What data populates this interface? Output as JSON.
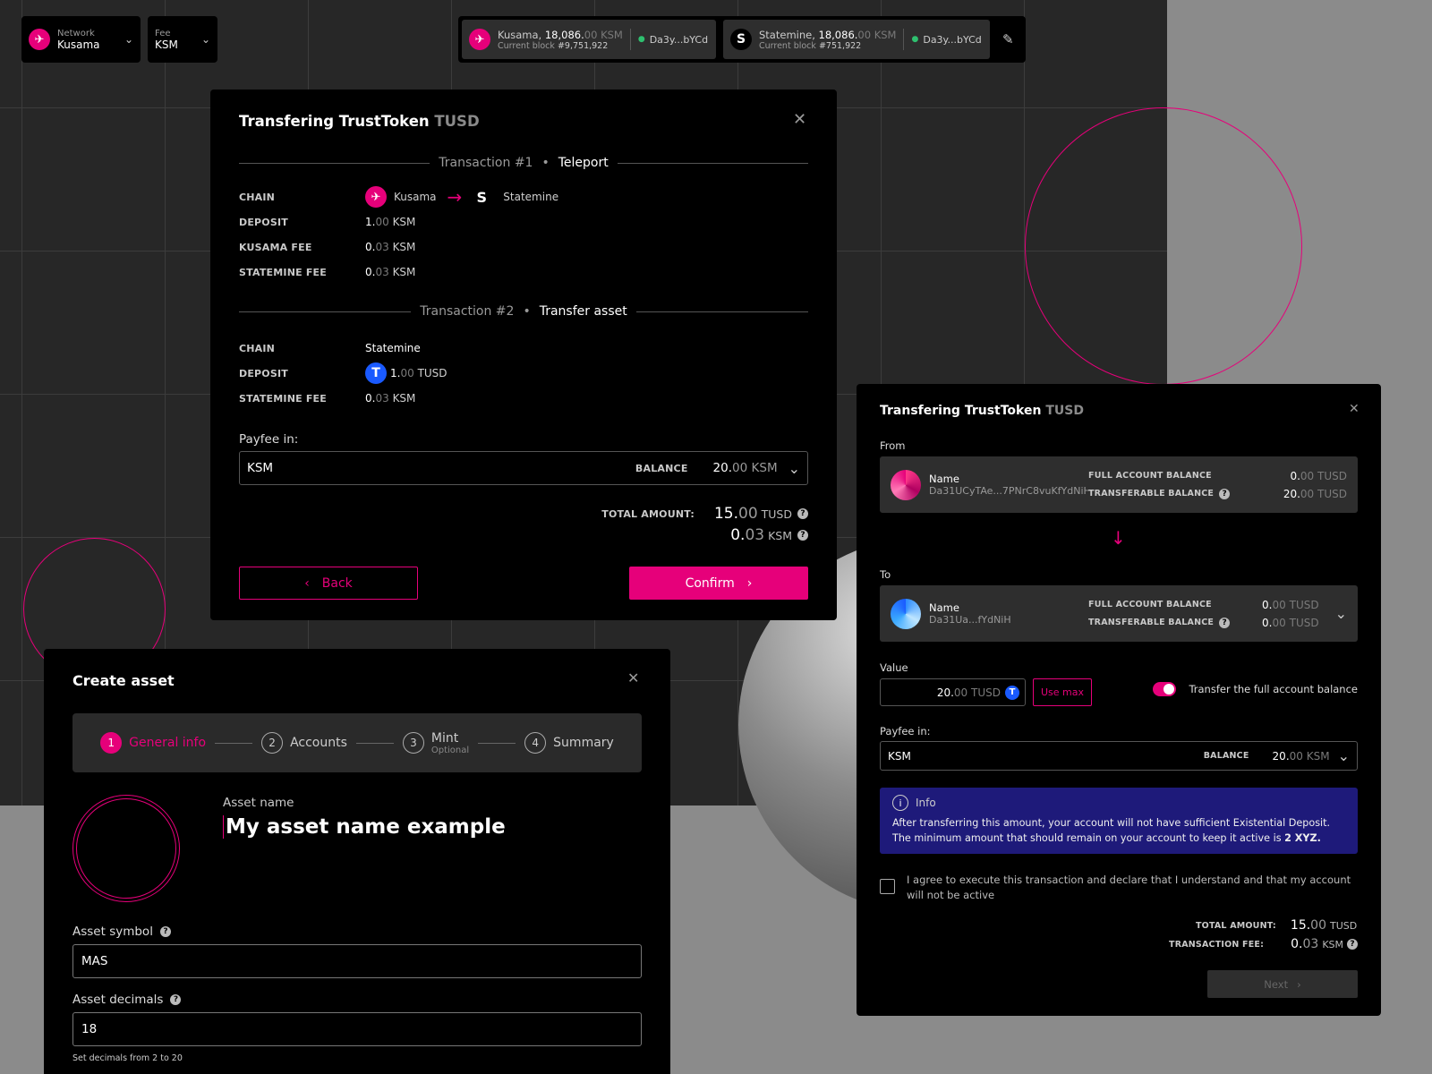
{
  "topbar": {
    "network_label": "Network",
    "network_value": "Kusama",
    "fee_label": "Fee",
    "fee_value": "KSM",
    "conn1": {
      "name": "Kusama,",
      "amount_int": "18,086.",
      "amount_dec": "00",
      "unit": "KSM",
      "block_label": "Current block",
      "block": "#9,751,922",
      "address": "Da3y...bYCd"
    },
    "conn2": {
      "name": "Statemine,",
      "amount_int": "18,086.",
      "amount_dec": "00",
      "unit": "KSM",
      "block_label": "Current block",
      "block": "#751,922",
      "address": "Da3y...bYCd"
    }
  },
  "teleport": {
    "title": "Transfering TrustToken",
    "title_symbol": "TUSD",
    "tx1_label": "Transaction #1",
    "tx1_type": "Teleport",
    "tx1": {
      "chain_label": "CHAIN",
      "from": "Kusama",
      "to": "Statemine",
      "deposit_label": "DEPOSIT",
      "deposit_int": "1.",
      "deposit_dec": "00",
      "deposit_unit": "KSM",
      "kfee_label": "KUSAMA FEE",
      "kfee_int": "0.",
      "kfee_dec": "03",
      "kfee_unit": "KSM",
      "sfee_label": "STATEMINE FEE",
      "sfee_int": "0.",
      "sfee_dec": "03",
      "sfee_unit": "KSM"
    },
    "tx2_label": "Transaction #2",
    "tx2_type": "Transfer asset",
    "tx2": {
      "chain_label": "CHAIN",
      "chain": "Statemine",
      "deposit_label": "DEPOSIT",
      "deposit_int": "1.",
      "deposit_dec": "00",
      "deposit_unit": "TUSD",
      "sfee_label": "STATEMINE FEE",
      "sfee_int": "0.",
      "sfee_dec": "03",
      "sfee_unit": "KSM"
    },
    "payfee_label": "Payfee in:",
    "payfee_value": "KSM",
    "balance_label": "BALANCE",
    "balance_int": "20.",
    "balance_dec": "00",
    "balance_unit": "KSM",
    "total_label": "TOTAL AMOUNT:",
    "total1_int": "15.",
    "total1_dec": "00",
    "total1_unit": "TUSD",
    "total2_int": "0.",
    "total2_dec": "03",
    "total2_unit": "KSM",
    "back": "Back",
    "confirm": "Confirm"
  },
  "transfer": {
    "title": "Transfering TrustToken",
    "title_symbol": "TUSD",
    "from_label": "From",
    "to_label": "To",
    "from": {
      "name": "Name",
      "address": "Da31UCyTAe...7PNrC8vuKfYdNiH",
      "full_label": "FULL ACCOUNT BALANCE",
      "full_int": "0.",
      "full_dec": "00",
      "full_unit": "TUSD",
      "trans_label": "TRANSFERABLE BALANCE",
      "trans_int": "20.",
      "trans_dec": "00",
      "trans_unit": "TUSD"
    },
    "to": {
      "name": "Name",
      "address": "Da31Ua...fYdNiH",
      "full_label": "FULL ACCOUNT BALANCE",
      "full_int": "0.",
      "full_dec": "00",
      "full_unit": "TUSD",
      "trans_label": "TRANSFERABLE BALANCE",
      "trans_int": "0.",
      "trans_dec": "00",
      "trans_unit": "TUSD"
    },
    "value_label": "Value",
    "value_int": "20.",
    "value_dec": "00",
    "value_unit": "TUSD",
    "use_max": "Use max",
    "toggle_label": "Transfer the full account balance",
    "payfee_label": "Payfee in:",
    "payfee_value": "KSM",
    "balance_label": "BALANCE",
    "balance_int": "20.",
    "balance_dec": "00",
    "balance_unit": "KSM",
    "info_title": "Info",
    "info_text": "After transferring this amount, your account will not have sufficient Existential Deposit. The minimum amount that should remain on your account to keep it active is",
    "info_amount": "2 XYZ.",
    "agree": "I agree to execute this transaction and declare that I understand and that my account will not be active",
    "total_label": "TOTAL AMOUNT:",
    "total_int": "15.",
    "total_dec": "00",
    "total_unit": "TUSD",
    "fee_label": "TRANSACTION FEE:",
    "fee_int": "0.",
    "fee_dec": "03",
    "fee_unit": "KSM",
    "next": "Next"
  },
  "create": {
    "title": "Create asset",
    "steps": [
      {
        "n": "1",
        "label": "General info"
      },
      {
        "n": "2",
        "label": "Accounts"
      },
      {
        "n": "3",
        "label": "Mint",
        "sub": "Optional"
      },
      {
        "n": "4",
        "label": "Summary"
      }
    ],
    "name_label": "Asset name",
    "name_value": "My asset name example",
    "symbol_label": "Asset symbol",
    "symbol_value": "MAS",
    "decimals_label": "Asset decimals",
    "decimals_value": "18",
    "decimals_hint": "Set decimals from 2 to 20"
  },
  "icons": [
    "kusama-icon",
    "statemine-icon",
    "tusd-icon",
    "chevron-down-icon",
    "edit-icon",
    "close-icon",
    "arrow-right-icon",
    "arrow-down-icon",
    "info-icon",
    "help-icon"
  ],
  "colors": {
    "accent": "#e6007a",
    "info_bg": "#1e1a7a",
    "tusd": "#1a5aff"
  }
}
